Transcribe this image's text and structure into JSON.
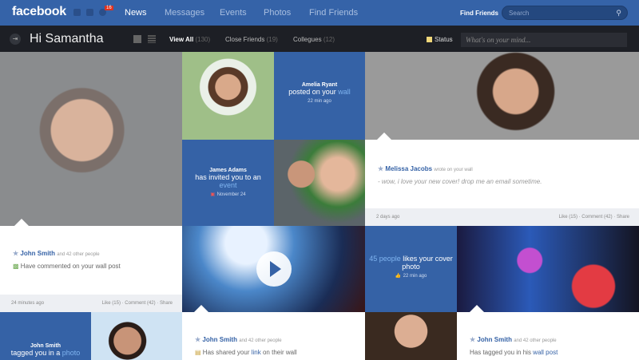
{
  "header": {
    "logo": "facebook",
    "notification_count": "16",
    "nav": [
      "News",
      "Messages",
      "Events",
      "Photos",
      "Find Friends"
    ],
    "find_friends": "Find Friends",
    "search_placeholder": "Search"
  },
  "subbar": {
    "greeting": "Hi Samantha",
    "filters": [
      {
        "label": "View All",
        "count": "(130)"
      },
      {
        "label": "Close Friends",
        "count": "(19)"
      },
      {
        "label": "Collegues",
        "count": "(12)"
      }
    ],
    "status_label": "Status",
    "status_placeholder": "What's on your mind..."
  },
  "feed": {
    "amelia": {
      "name": "Amelia Ryant",
      "text": "posted on your",
      "link": "wall",
      "time": "22 min ago"
    },
    "james": {
      "name": "James Adams",
      "text": "has invited you to an",
      "link": "event",
      "date": "November 24"
    },
    "melissa": {
      "name": "Melissa Jacobs",
      "sub": "wrote on your wall",
      "msg": "- wow, i love your new cover! drop me an email sometime.",
      "time": "2 days ago",
      "actions": "Like (15) · Comment (42) · Share"
    },
    "john1": {
      "name": "John Smith",
      "sub": "and 42 other people",
      "msg": "Have commented on your wall post",
      "time": "24 minutes ago",
      "actions": "Like (15) · Comment (42) · Share"
    },
    "likes": {
      "link": "45 people",
      "text": "likes your cover photo",
      "time": "22 min ago"
    },
    "john2": {
      "name": "John Smith",
      "text": "tagged you in a",
      "link": "photo"
    },
    "john3": {
      "name": "John Smith",
      "sub": "and 42 other people",
      "msg": "Has shared your",
      "link": "link",
      "msg2": "on their wall"
    },
    "john4": {
      "name": "John Smith",
      "sub": "and 42 other people",
      "msg": "Has tagged you in his",
      "link": "wall post"
    }
  }
}
